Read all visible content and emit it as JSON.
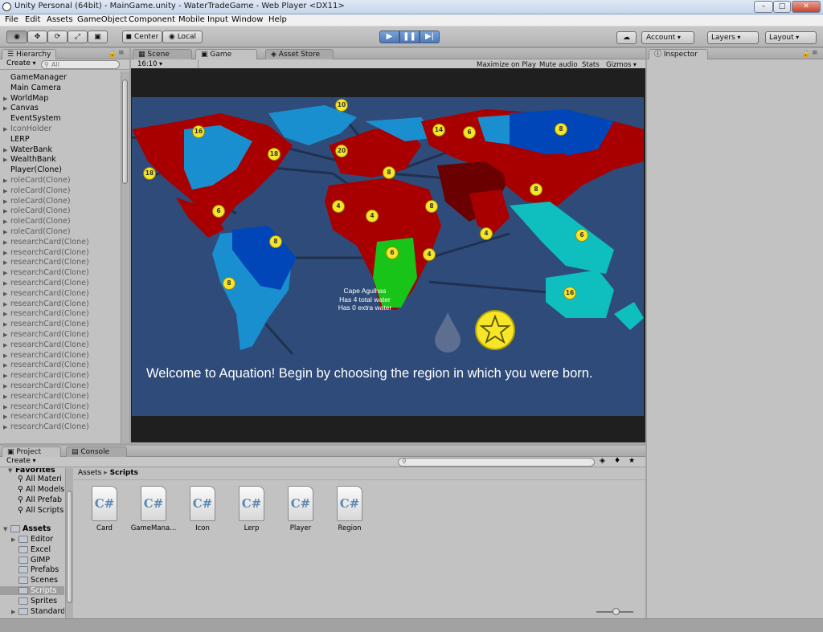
{
  "window": {
    "title": "Unity Personal (64bit) - MainGame.unity - WaterTradeGame - Web Player <DX11>",
    "controls": [
      "minimize",
      "maximize",
      "close"
    ]
  },
  "menu": [
    "File",
    "Edit",
    "Assets",
    "GameObject",
    "Component",
    "Mobile Input",
    "Window",
    "Help"
  ],
  "toolbar": {
    "tools": [
      "eye-icon",
      "move-icon",
      "rotate-icon",
      "scale-icon",
      "rect-icon"
    ],
    "pivot": "Center",
    "space": "Local",
    "account": "Account",
    "layers": "Layers",
    "layout": "Layout"
  },
  "hierarchy": {
    "tab": "Hierarchy",
    "create": "Create",
    "search_placeholder": "All",
    "items": [
      {
        "label": "GameManager",
        "expand": false,
        "grey": false
      },
      {
        "label": "Main Camera",
        "expand": false,
        "grey": false
      },
      {
        "label": "WorldMap",
        "expand": true,
        "grey": false
      },
      {
        "label": "Canvas",
        "expand": true,
        "grey": false
      },
      {
        "label": "EventSystem",
        "expand": false,
        "grey": false
      },
      {
        "label": "IconHolder",
        "expand": true,
        "grey": true
      },
      {
        "label": "LERP",
        "expand": false,
        "grey": false
      },
      {
        "label": "WaterBank",
        "expand": true,
        "grey": false
      },
      {
        "label": "WealthBank",
        "expand": true,
        "grey": false
      },
      {
        "label": "Player(Clone)",
        "expand": false,
        "grey": false
      },
      {
        "label": "roleCard(Clone)",
        "expand": true,
        "grey": true
      },
      {
        "label": "roleCard(Clone)",
        "expand": true,
        "grey": true
      },
      {
        "label": "roleCard(Clone)",
        "expand": true,
        "grey": true
      },
      {
        "label": "roleCard(Clone)",
        "expand": true,
        "grey": true
      },
      {
        "label": "roleCard(Clone)",
        "expand": true,
        "grey": true
      },
      {
        "label": "roleCard(Clone)",
        "expand": true,
        "grey": true
      },
      {
        "label": "researchCard(Clone)",
        "expand": true,
        "grey": true
      },
      {
        "label": "researchCard(Clone)",
        "expand": true,
        "grey": true
      },
      {
        "label": "researchCard(Clone)",
        "expand": true,
        "grey": true
      },
      {
        "label": "researchCard(Clone)",
        "expand": true,
        "grey": true
      },
      {
        "label": "researchCard(Clone)",
        "expand": true,
        "grey": true
      },
      {
        "label": "researchCard(Clone)",
        "expand": true,
        "grey": true
      },
      {
        "label": "researchCard(Clone)",
        "expand": true,
        "grey": true
      },
      {
        "label": "researchCard(Clone)",
        "expand": true,
        "grey": true
      },
      {
        "label": "researchCard(Clone)",
        "expand": true,
        "grey": true
      },
      {
        "label": "researchCard(Clone)",
        "expand": true,
        "grey": true
      },
      {
        "label": "researchCard(Clone)",
        "expand": true,
        "grey": true
      },
      {
        "label": "researchCard(Clone)",
        "expand": true,
        "grey": true
      },
      {
        "label": "researchCard(Clone)",
        "expand": true,
        "grey": true
      },
      {
        "label": "researchCard(Clone)",
        "expand": true,
        "grey": true
      },
      {
        "label": "researchCard(Clone)",
        "expand": true,
        "grey": true
      },
      {
        "label": "researchCard(Clone)",
        "expand": true,
        "grey": true
      },
      {
        "label": "researchCard(Clone)",
        "expand": true,
        "grey": true
      },
      {
        "label": "researchCard(Clone)",
        "expand": true,
        "grey": true
      },
      {
        "label": "researchCard(Clone)",
        "expand": true,
        "grey": true
      }
    ]
  },
  "center_tabs": {
    "scene": "Scene",
    "game": "Game",
    "asset_store": "Asset Store"
  },
  "game_toolbar": {
    "aspect": "16:10",
    "maximize": "Maximize on Play",
    "mute": "Mute audio",
    "stats": "Stats",
    "gizmos": "Gizmos"
  },
  "game_view": {
    "tooltip_lines": [
      "Cape Agulhas",
      "Has 4 total water",
      "Has 0 extra water"
    ],
    "message": "Welcome to Aquation! Begin by choosing the region in which you were born.",
    "markers": [
      "10",
      "16",
      "14",
      "6",
      "8",
      "18",
      "20",
      "18",
      "8",
      "6",
      "4",
      "4",
      "8",
      "8",
      "8",
      "6",
      "4",
      "4",
      "6",
      "8",
      "16"
    ],
    "colors": {
      "ocean": "#2f4b79",
      "dark_red": "#a80000",
      "blue": "#0046b8",
      "light_blue": "#1a8fd0",
      "teal": "#0fbfbf",
      "green": "#18c418",
      "maroon": "#6b0000",
      "marker": "#f7e52a"
    }
  },
  "inspector": {
    "tab": "Inspector"
  },
  "project": {
    "tab": "Project",
    "console_tab": "Console",
    "create": "Create",
    "favorites_label": "Favorites",
    "favorites": [
      "All Materi",
      "All Models",
      "All Prefab",
      "All Scripts"
    ],
    "assets_label": "Assets",
    "folders": [
      "Editor",
      "Excel",
      "GIMP",
      "Prefabs",
      "Scenes",
      "Scripts",
      "Sprites",
      "Standard"
    ],
    "breadcrumb": [
      "Assets",
      "Scripts"
    ],
    "files": [
      {
        "name": "Card",
        "icon_text": "C#"
      },
      {
        "name": "GameMana...",
        "icon_text": "C#"
      },
      {
        "name": "Icon",
        "icon_text": "C#"
      },
      {
        "name": "Lerp",
        "icon_text": "C#"
      },
      {
        "name": "Player",
        "icon_text": "C#"
      },
      {
        "name": "Region",
        "icon_text": "C#"
      }
    ]
  }
}
